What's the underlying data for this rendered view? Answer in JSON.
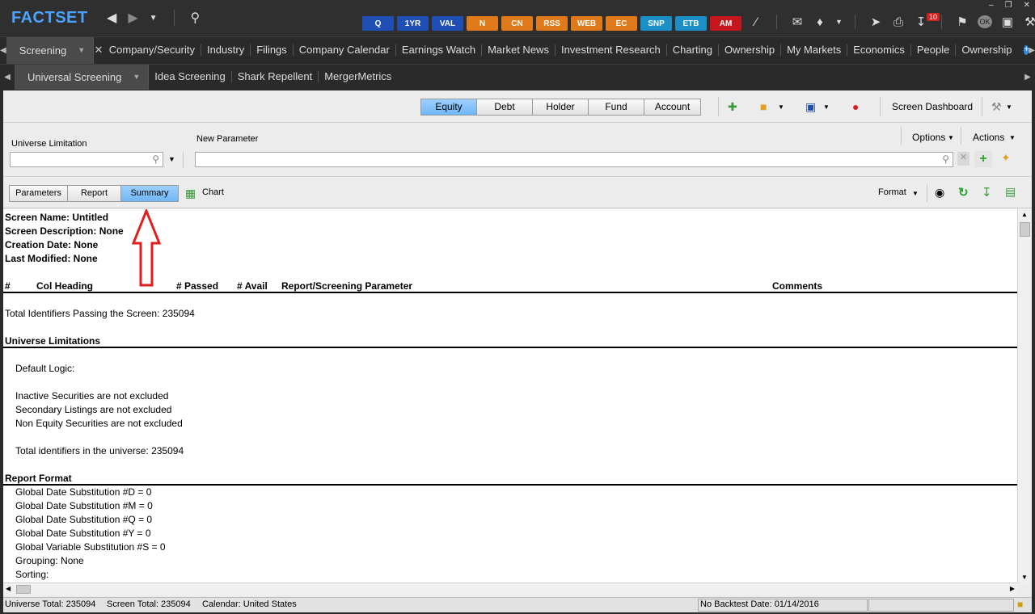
{
  "app": {
    "logo": "FACTSET",
    "quick_buttons": [
      {
        "label": "Q",
        "color": "#1f4fb5"
      },
      {
        "label": "1YR",
        "color": "#1f4fb5"
      },
      {
        "label": "VAL",
        "color": "#1f4fb5"
      },
      {
        "label": "N",
        "color": "#e07a1a"
      },
      {
        "label": "CN",
        "color": "#e07a1a"
      },
      {
        "label": "RSS",
        "color": "#e07a1a"
      },
      {
        "label": "WEB",
        "color": "#e07a1a"
      },
      {
        "label": "EC",
        "color": "#e07a1a"
      },
      {
        "label": "SNP",
        "color": "#1a8fc8"
      },
      {
        "label": "ETB",
        "color": "#1a8fc8"
      },
      {
        "label": "AM",
        "color": "#c4161c"
      }
    ],
    "notification_count": "10"
  },
  "tabs_primary": {
    "active": "Screening",
    "items": [
      "Company/Security",
      "Industry",
      "Filings",
      "Company Calendar",
      "Earnings Watch",
      "Market News",
      "Investment Research",
      "Charting",
      "Ownership",
      "My Markets",
      "Economics",
      "People",
      "Ownership"
    ]
  },
  "tabs_secondary": {
    "active": "Universal Screening",
    "items": [
      "Idea Screening",
      "Shark Repellent",
      "MergerMetrics"
    ]
  },
  "toolbar": {
    "segments": [
      "Equity",
      "Debt",
      "Holder",
      "Fund",
      "Account"
    ],
    "active_segment": "Equity",
    "screen_dashboard": "Screen Dashboard"
  },
  "params": {
    "universe_label": "Universe Limitation",
    "universe_value": "",
    "new_param_label": "New Parameter",
    "new_param_value": "",
    "options": "Options",
    "actions": "Actions"
  },
  "view": {
    "tabs": [
      "Parameters",
      "Report",
      "Summary"
    ],
    "active": "Summary",
    "chart": "Chart",
    "format": "Format"
  },
  "summary": {
    "screen_name": "Screen Name:  Untitled",
    "screen_desc": "Screen Description:  None",
    "creation_date": "Creation Date:  None",
    "last_modified": "Last Modified:  None",
    "col_hash": "#",
    "col_heading": "Col Heading",
    "col_passed": "# Passed",
    "col_avail": "# Avail",
    "col_param": "Report/Screening Parameter",
    "col_comments": "Comments",
    "total_passing": "Total Identifiers Passing the Screen:  235094",
    "universe_heading": "Universe Limitations",
    "default_logic": "Default Logic:",
    "inactive": "Inactive Securities are not excluded",
    "secondary": "Secondary Listings are not excluded",
    "non_equity": "Non Equity Securities are not excluded",
    "total_universe": "Total identifiers in the universe:  235094",
    "report_heading": "Report Format",
    "report_lines": [
      "Global Date Substitution #D = 0",
      "Global Date Substitution #M = 0",
      "Global Date Substitution #Q = 0",
      "Global Date Substitution #Y = 0",
      "Global Variable Substitution #S = 0",
      "Grouping:  None",
      "Sorting:"
    ]
  },
  "status": {
    "universe_total": "Universe Total:  235094",
    "screen_total": "Screen Total:  235094",
    "calendar": "Calendar:  United States",
    "backtest": "No Backtest Date: 01/14/2016"
  }
}
